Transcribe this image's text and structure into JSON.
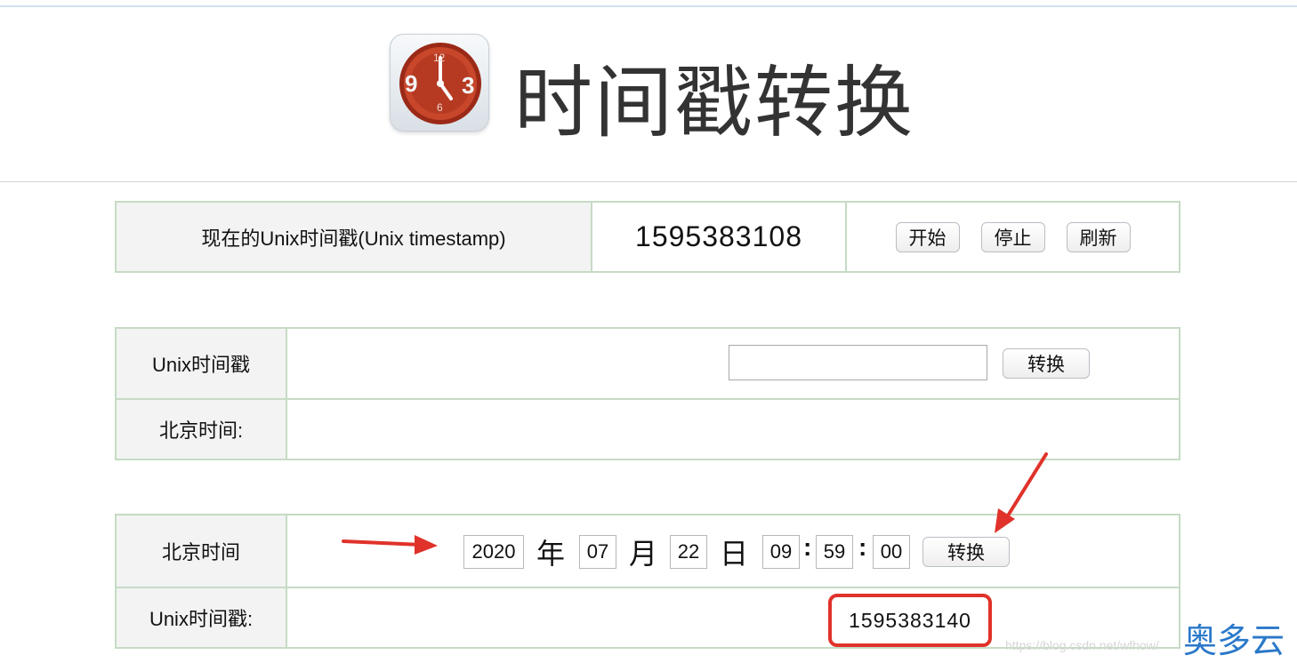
{
  "header": {
    "title": "时间戳转换",
    "logo_icon": "clock-icon",
    "logo_digits": [
      "9",
      "3",
      "12",
      "6"
    ]
  },
  "current_panel": {
    "label": "现在的Unix时间戳(Unix timestamp)",
    "timestamp": "1595383108",
    "start_label": "开始",
    "stop_label": "停止",
    "refresh_label": "刷新"
  },
  "unix_to_beijing": {
    "unix_label": "Unix时间戳",
    "input_value": "",
    "convert_label": "转换",
    "beijing_label": "北京时间:",
    "beijing_value": ""
  },
  "beijing_to_unix": {
    "beijing_label": "北京时间",
    "year": "2020",
    "year_unit": "年",
    "month": "07",
    "month_unit": "月",
    "day": "22",
    "day_unit": "日",
    "hour": "09",
    "minute": "59",
    "second": "00",
    "colon": ":",
    "convert_label": "转换",
    "unix_label": "Unix时间戳:",
    "unix_value": "1595383140"
  },
  "annotations": {
    "arrow_color": "#e0322a",
    "highlight_color": "#e0322a"
  },
  "footer": {
    "watermark": "https://blog.csdn.net/wfhow/",
    "brand": "奥多云"
  },
  "colors": {
    "border": "#c6dbc4",
    "label_bg": "#f3f3f3",
    "accent_blue": "#2a78c9"
  }
}
